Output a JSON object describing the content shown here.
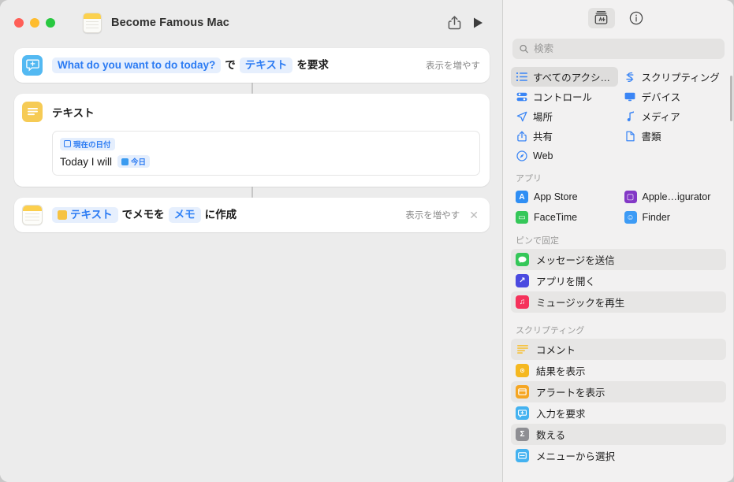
{
  "window": {
    "title": "Become Famous Mac",
    "traffic_lights": [
      "close",
      "minimize",
      "zoom"
    ],
    "doc_icon": "notes-document-icon",
    "toolbar": {
      "share_label": "share-icon",
      "play_label": "play-icon"
    }
  },
  "workflow": {
    "actions": [
      {
        "icon": "ask-for-input-icon",
        "icon_color": "#53b9f2",
        "parts": [
          {
            "type": "token",
            "text": "What do you want to do today?"
          },
          {
            "type": "plain",
            "text": "で"
          },
          {
            "type": "token",
            "text": "テキスト"
          },
          {
            "type": "plain",
            "text": "を要求"
          }
        ],
        "more_label": "表示を増やす",
        "has_close": false
      },
      {
        "icon": "text-action-icon",
        "icon_color": "#f6cb55",
        "title": "テキスト",
        "field": {
          "chip_top": "現在の日付",
          "body_text": "Today I will",
          "chip_inline": "今日"
        }
      },
      {
        "icon": "notes-app-icon",
        "parts": [
          {
            "type": "token_icon",
            "text": "テキスト"
          },
          {
            "type": "plain",
            "text": "でメモを"
          },
          {
            "type": "token",
            "text": "メモ"
          },
          {
            "type": "plain",
            "text": "に作成"
          }
        ],
        "more_label": "表示を増やす",
        "has_close": true,
        "close_label": "✕"
      }
    ]
  },
  "sidebar": {
    "toolbar": {
      "library_button": "action-library-icon",
      "info_button": "info-icon"
    },
    "search": {
      "placeholder": "検索",
      "value": "",
      "icon": "search-icon"
    },
    "categories": [
      {
        "label": "すべてのアクシ…",
        "icon": "list-icon",
        "color": "#3a85f5",
        "selected": true
      },
      {
        "label": "スクリプティング",
        "icon": "scripting-icon",
        "color": "#3a85f5",
        "selected": false
      },
      {
        "label": "コントロール",
        "icon": "controls-icon",
        "color": "#3a85f5",
        "selected": false
      },
      {
        "label": "デバイス",
        "icon": "device-icon",
        "color": "#3a85f5",
        "selected": false
      },
      {
        "label": "場所",
        "icon": "location-icon",
        "color": "#3a85f5",
        "selected": false
      },
      {
        "label": "メディア",
        "icon": "media-note-icon",
        "color": "#3a85f5",
        "selected": false
      },
      {
        "label": "共有",
        "icon": "share-icon",
        "color": "#3a85f5",
        "selected": false
      },
      {
        "label": "書類",
        "icon": "document-icon",
        "color": "#3a85f5",
        "selected": false
      },
      {
        "label": "Web",
        "icon": "safari-compass-icon",
        "color": "#3a85f5",
        "selected": false
      }
    ],
    "apps_section": {
      "header": "アプリ",
      "items": [
        {
          "label": "App Store",
          "icon": "app-store-icon",
          "color": "#2f8ef4",
          "glyph": "A"
        },
        {
          "label": "Apple…igurator",
          "icon": "apple-configurator-icon",
          "color": "#8338c6",
          "glyph": "⬓"
        },
        {
          "label": "FaceTime",
          "icon": "facetime-icon",
          "color": "#35c759",
          "glyph": "▭"
        },
        {
          "label": "Finder",
          "icon": "finder-icon",
          "color": "#3d9bf5",
          "glyph": "☺"
        }
      ]
    },
    "pinned_section": {
      "header": "ピンで固定",
      "items": [
        {
          "label": "メッセージを送信",
          "icon": "messages-icon",
          "color": "#35c759",
          "glyph": "💬",
          "alt": true
        },
        {
          "label": "アプリを開く",
          "icon": "open-app-icon",
          "color": "#4b4ae0",
          "glyph": "↗",
          "alt": false
        },
        {
          "label": "ミュージックを再生",
          "icon": "music-icon",
          "color": "#f5325b",
          "glyph": "♫",
          "alt": true
        }
      ]
    },
    "scripting_section": {
      "header": "スクリプティング",
      "items": [
        {
          "label": "コメント",
          "icon": "comment-icon",
          "color": "#f6c343",
          "glyph": "≡",
          "alt": true
        },
        {
          "label": "結果を表示",
          "icon": "show-result-icon",
          "color": "#f5b820",
          "glyph": "◻",
          "alt": false
        },
        {
          "label": "アラートを表示",
          "icon": "show-alert-icon",
          "color": "#f5a623",
          "glyph": "▭",
          "alt": true
        },
        {
          "label": "入力を要求",
          "icon": "ask-for-input-icon",
          "color": "#44b2f0",
          "glyph": "💬",
          "alt": false
        },
        {
          "label": "数える",
          "icon": "count-icon",
          "color": "#8e8e93",
          "glyph": "Σ",
          "alt": true
        },
        {
          "label": "メニューから選択",
          "icon": "choose-from-menu-icon",
          "color": "#44b2f0",
          "glyph": "▤",
          "alt": false
        }
      ]
    }
  }
}
